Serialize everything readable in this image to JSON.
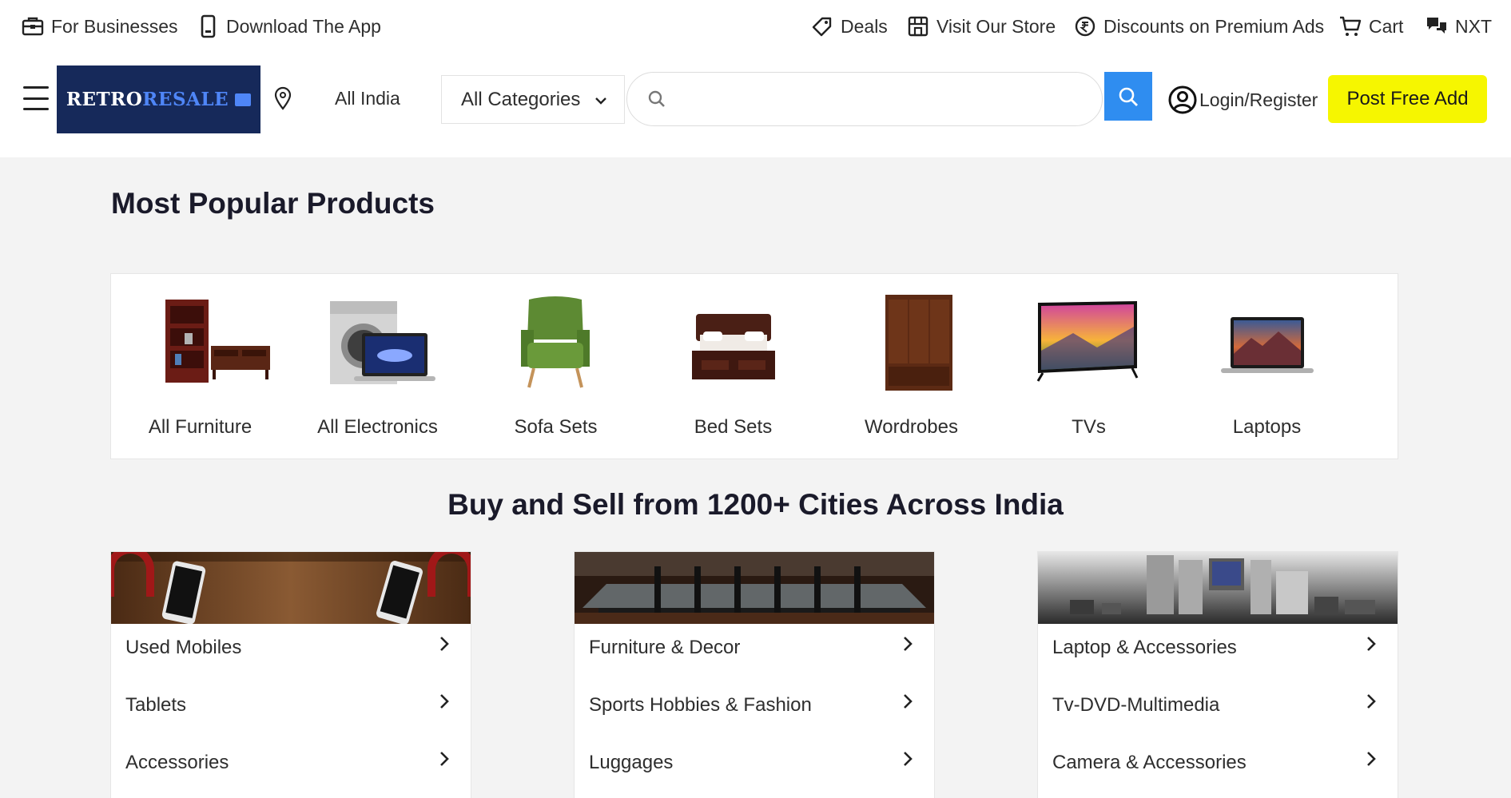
{
  "topbar": {
    "for_businesses": "For Businesses",
    "download_app": "Download The App",
    "deals": "Deals",
    "visit_store": "Visit Our Store",
    "discounts": "Discounts on Premium Ads",
    "cart": "Cart",
    "nxt": "NXT"
  },
  "header": {
    "logo_part1": "RETRO",
    "logo_part2": "RESALE",
    "location": "All India",
    "category_selected": "All Categories",
    "search_value": "",
    "login": "Login/Register",
    "post_button": "Post Free Add"
  },
  "popular": {
    "title": "Most Popular Products",
    "items": [
      {
        "label": "All Furniture",
        "icon": "furniture-image"
      },
      {
        "label": "All Electronics",
        "icon": "electronics-image"
      },
      {
        "label": "Sofa Sets",
        "icon": "sofa-image"
      },
      {
        "label": "Bed Sets",
        "icon": "bed-image"
      },
      {
        "label": "Wordrobes",
        "icon": "wardrobe-image"
      },
      {
        "label": "TVs",
        "icon": "tv-image"
      },
      {
        "label": "Laptops",
        "icon": "laptop-image"
      }
    ]
  },
  "cities": {
    "title": "Buy and Sell from 1200+ Cities Across India",
    "columns": [
      {
        "banner": "mobiles-banner",
        "items": [
          "Used Mobiles",
          "Tablets",
          "Accessories"
        ]
      },
      {
        "banner": "furniture-banner",
        "items": [
          "Furniture & Decor",
          "Sports Hobbies & Fashion",
          "Luggages"
        ]
      },
      {
        "banner": "electronics-banner",
        "items": [
          "Laptop & Accessories",
          "Tv-DVD-Multimedia",
          "Camera & Accessories"
        ]
      }
    ]
  },
  "colors": {
    "brand_navy": "#16295a",
    "brand_blue": "#4f86f7",
    "search_button": "#2f8df0",
    "post_button": "#f6f600",
    "background": "#f3f3f3"
  }
}
